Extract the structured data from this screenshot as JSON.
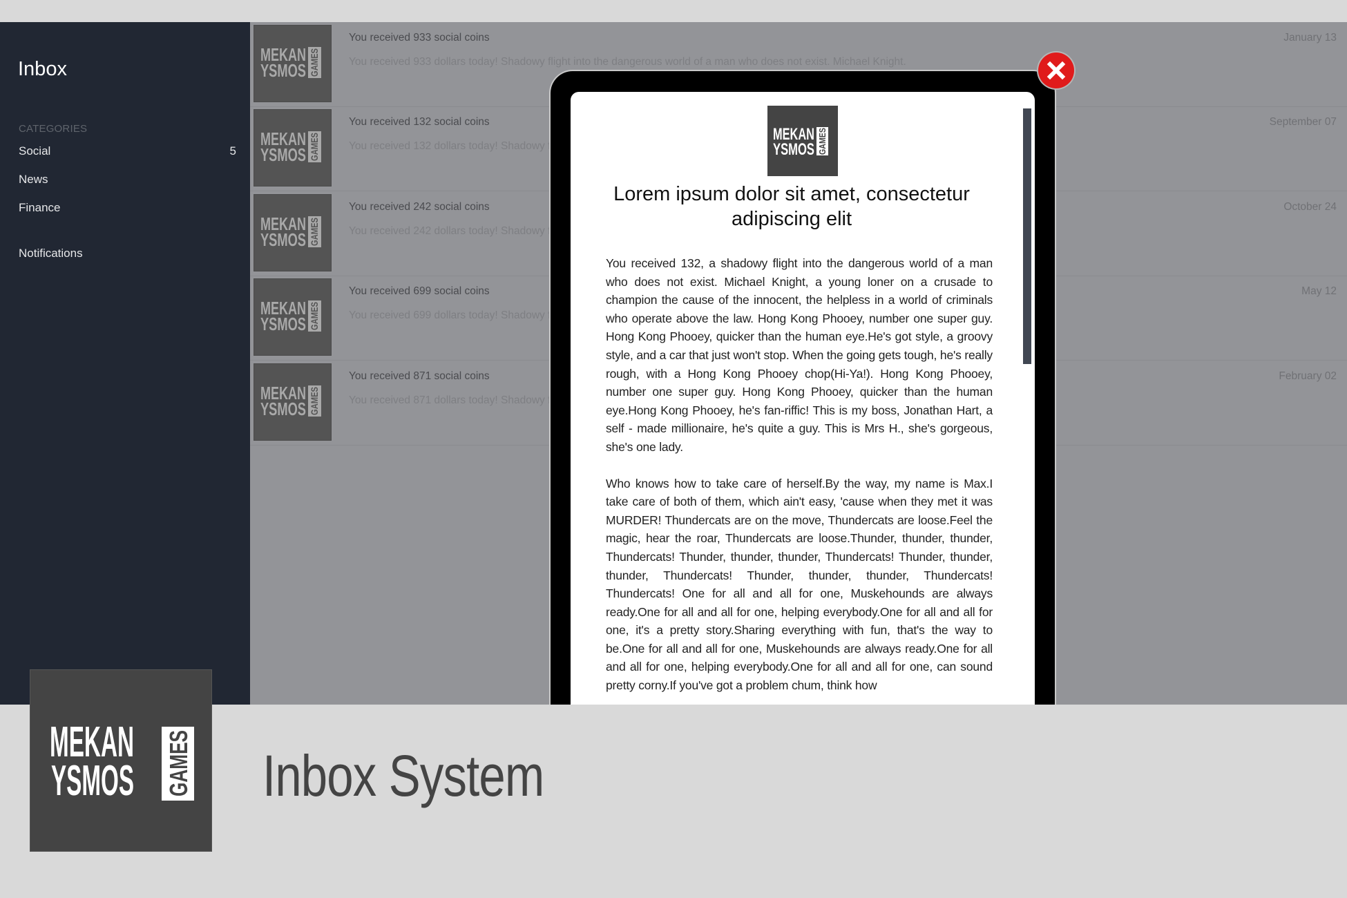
{
  "sidebar": {
    "title": "Inbox",
    "categories_label": "CATEGORIES",
    "items": [
      {
        "label": "Social",
        "count": "5"
      },
      {
        "label": "News",
        "count": ""
      },
      {
        "label": "Finance",
        "count": ""
      }
    ],
    "notifications_label": "Notifications"
  },
  "brand": {
    "line1": "MEKAN",
    "line2": "YSMOS",
    "side": "GAMES"
  },
  "messages": [
    {
      "title": "You received 933 social coins",
      "preview": "You received 933 dollars today! Shadowy flight into the dangerous world of a man who does not exist. Michael Knight.",
      "date": "January 13"
    },
    {
      "title": "You received 132 social coins",
      "preview": "You received 132 dollars today! Shadowy flight into the dangerous world of a man who does not exist. Michael Knight.",
      "date": "September 07"
    },
    {
      "title": "You received 242 social coins",
      "preview": "You received 242 dollars today! Shadowy flight into the dangerous world of a man who does not exist. Michael Knight.",
      "date": "October 24"
    },
    {
      "title": "You received 699 social coins",
      "preview": "You received 699 dollars today! Shadowy flight into the dangerous world of a man who does not exist. Michael Knight.",
      "date": "May 12"
    },
    {
      "title": "You received 871 social coins",
      "preview": "You received 871 dollars today! Shadowy flight into the dangerous world of a man who does not exist. Michael Knight.",
      "date": "February 02"
    }
  ],
  "modal": {
    "heading": "Lorem ipsum dolor sit amet, consectetur adipiscing elit",
    "paragraphs": [
      "You received 132, a shadowy flight into the dangerous world of a man who does not exist. Michael Knight, a young loner on a crusade to champion the cause of the innocent, the helpless in a world of criminals who operate above the law. Hong Kong Phooey, number one super guy. Hong Kong Phooey, quicker than the human eye.He's got style, a groovy style, and a car that just won't stop. When the going gets tough, he's really rough, with a Hong Kong Phooey chop(Hi-Ya!). Hong Kong Phooey, number one super guy. Hong Kong Phooey, quicker than the human eye.Hong Kong Phooey, he's fan-riffic! This is my boss, Jonathan Hart, a self - made millionaire, he's quite a guy. This is Mrs H., she's gorgeous, she's one lady.",
      "Who knows how to take care of herself.By the way, my name is Max.I take care of both of them, which ain't easy, 'cause when they met it was MURDER! Thundercats are on the move, Thundercats are loose.Feel the magic, hear the roar, Thundercats are loose.Thunder, thunder, thunder, Thundercats! Thunder, thunder, thunder, Thundercats! Thunder, thunder, thunder, Thundercats! Thunder, thunder, thunder, Thundercats! Thundercats! One for all and all for one, Muskehounds are always ready.One for all and all for one, helping everybody.One for all and all for one, it's a pretty story.Sharing everything with fun, that's the way to be.One for all and all for one, Muskehounds are always ready.One for all and all for one, helping everybody.One for all and all for one, can sound pretty corny.If you've got a problem chum, think how"
    ],
    "close_icon": "close-x-icon"
  },
  "banner": {
    "title": "Inbox System"
  },
  "colors": {
    "sidebar_bg": "#212733",
    "overlay_bg": "#939498",
    "close_red": "#e01b1b",
    "logo_bg": "#444444"
  }
}
